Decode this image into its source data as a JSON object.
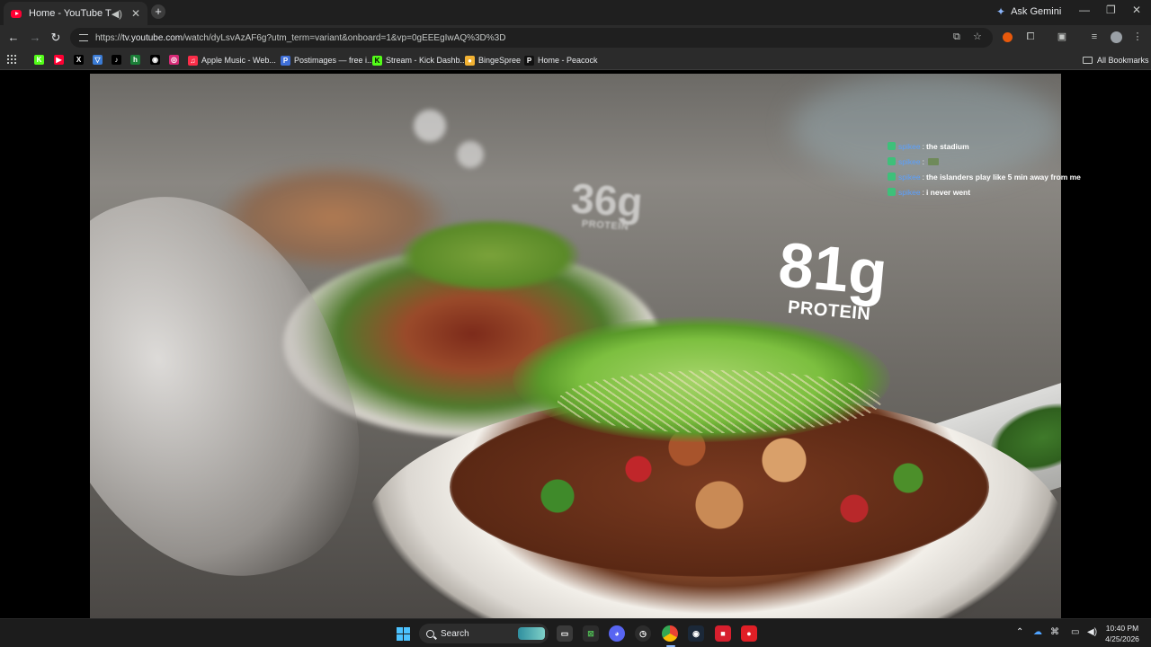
{
  "browser": {
    "tab": {
      "title": "Home - YouTube TV",
      "favicon": "youtube-icon",
      "audio_icon": "speaker-icon"
    },
    "ask_gemini": "Ask Gemini",
    "address_bar": {
      "url_prefix": "https://",
      "url_host": "tv.youtube.com",
      "url_rest": "/watch/dyLsvAzAF6g?utm_term=variant&onboard=1&vp=0gEEEgIwAQ%3D%3D"
    },
    "bookmarks": [
      {
        "label": "Apple Music - Web...",
        "icon": "apple-music-icon",
        "color": "#fa2d48"
      },
      {
        "label": "Postimages — free i...",
        "icon": "postimages-icon",
        "color": "#3f6fd8"
      },
      {
        "label": "Stream - Kick Dashb...",
        "icon": "kick-icon",
        "color": "#53fc18"
      },
      {
        "label": "BingeSpree",
        "icon": "bingespree-icon",
        "color": "#f2b233"
      },
      {
        "label": "Home - Peacock",
        "icon": "peacock-icon",
        "color": "#111111"
      }
    ],
    "bookmark_icons": [
      {
        "letter": "K",
        "color": "#53fc18"
      },
      {
        "letter": "▶",
        "color": "#ff0033"
      },
      {
        "letter": "X",
        "color": "#000000"
      },
      {
        "letter": "▽",
        "color": "#3a7bd5"
      },
      {
        "letter": "♪",
        "color": "#000000"
      },
      {
        "letter": "h",
        "color": "#1a7f37"
      },
      {
        "letter": "◉",
        "color": "#000000"
      },
      {
        "letter": "◎",
        "color": "#d62976"
      }
    ],
    "all_bookmarks": "All Bookmarks"
  },
  "video": {
    "overlay_small": {
      "amount": "36g",
      "label": "PROTEIN"
    },
    "overlay_large": {
      "amount": "81g",
      "label": "PROTEIN"
    }
  },
  "chat": [
    {
      "user": "spikee",
      "message": "the stadium",
      "emote": false
    },
    {
      "user": "spikee",
      "message": "",
      "emote": true
    },
    {
      "user": "spikee",
      "message": "the islanders play like 5 min away from me",
      "emote": false
    },
    {
      "user": "spikee",
      "message": "i never went",
      "emote": false
    }
  ],
  "taskbar": {
    "search_placeholder": "Search",
    "clock_time": "10:40 PM",
    "clock_date": "4/25/2026"
  }
}
